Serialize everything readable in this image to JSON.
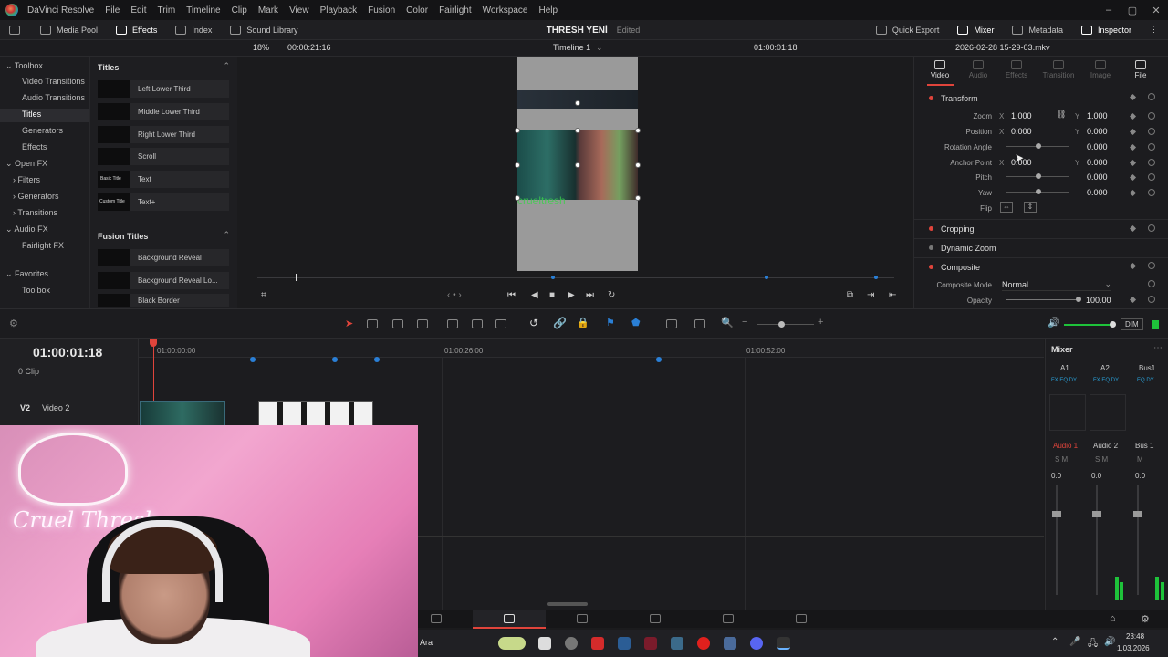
{
  "menubar": {
    "app_title": "DaVinci Resolve",
    "items": [
      "File",
      "Edit",
      "Trim",
      "Timeline",
      "Clip",
      "Mark",
      "View",
      "Playback",
      "Fusion",
      "Color",
      "Fairlight",
      "Workspace",
      "Help"
    ]
  },
  "toolbar": {
    "media_pool": "Media Pool",
    "effects": "Effects",
    "index": "Index",
    "sound_library": "Sound Library",
    "project_title": "THRESH YENİ",
    "project_status": "Edited",
    "quick_export": "Quick Export",
    "mixer": "Mixer",
    "metadata": "Metadata",
    "inspector": "Inspector"
  },
  "subbar": {
    "zoom": "18%",
    "source_timecode": "00:00:21:16",
    "timeline_name": "Timeline 1",
    "record_timecode": "01:00:01:18",
    "clip_name": "2026-02-28 15-29-03.mkv"
  },
  "toolbox": {
    "items": [
      {
        "label": "Toolbox",
        "level": 0
      },
      {
        "label": "Video Transitions",
        "level": 1
      },
      {
        "label": "Audio Transitions",
        "level": 1
      },
      {
        "label": "Titles",
        "level": 1
      },
      {
        "label": "Generators",
        "level": 1
      },
      {
        "label": "Effects",
        "level": 1
      },
      {
        "label": "Open FX",
        "level": 0
      },
      {
        "label": "Filters",
        "level": 1
      },
      {
        "label": "Generators",
        "level": 1
      },
      {
        "label": "Transitions",
        "level": 1
      },
      {
        "label": "Audio FX",
        "level": 0
      },
      {
        "label": "Fairlight FX",
        "level": 1
      },
      {
        "label": "Favorites",
        "level": 0
      },
      {
        "label": "Toolbox",
        "level": 1
      }
    ]
  },
  "titles": {
    "header": "Titles",
    "items": [
      "Left Lower Third",
      "Middle Lower Third",
      "Right Lower Third",
      "Scroll",
      "Text",
      "Text+"
    ],
    "thumb_labels": [
      "",
      "",
      "",
      "",
      "Basic Title",
      "Custom Title"
    ],
    "fusion_header": "Fusion Titles",
    "fusion_items": [
      "Background Reveal",
      "Background Reveal Lo...",
      "Black Border"
    ]
  },
  "viewer": {
    "watermark_text": "crueltresh"
  },
  "inspector": {
    "tabs": [
      "Video",
      "Audio",
      "Effects",
      "Transition",
      "Image",
      "File"
    ],
    "transform_label": "Transform",
    "zoom_label": "Zoom",
    "zoom_x": "1.000",
    "zoom_y": "1.000",
    "position_label": "Position",
    "position_x": "0.000",
    "position_y": "0.000",
    "rotation_label": "Rotation Angle",
    "rotation_val": "0.000",
    "anchor_label": "Anchor Point",
    "anchor_x": "0.000",
    "anchor_y": "0.000",
    "pitch_label": "Pitch",
    "pitch_val": "0.000",
    "yaw_label": "Yaw",
    "yaw_val": "0.000",
    "flip_label": "Flip",
    "x_axis": "X",
    "y_axis": "Y",
    "cropping_label": "Cropping",
    "dynamic_zoom_label": "Dynamic Zoom",
    "composite_label": "Composite",
    "composite_mode_label": "Composite Mode",
    "composite_mode_val": "Normal",
    "opacity_label": "Opacity",
    "opacity_val": "100.00"
  },
  "timeline": {
    "timecode": "01:00:01:18",
    "clip_count": "0 Clip",
    "ruler": [
      "01:00:00:00",
      "01:00:26:00",
      "01:00:52:00"
    ],
    "track_v2_id": "V2",
    "track_v2_name": "Video 2"
  },
  "mixer": {
    "title": "Mixer",
    "channels": [
      "A1",
      "A2",
      "Bus1"
    ],
    "channel_names": [
      "Audio 1",
      "Audio 2",
      "Bus 1"
    ],
    "levels": [
      "0.0",
      "0.0",
      "0.0"
    ],
    "dim_label": "DIM"
  },
  "webcam": {
    "neon_text": "Cruel Thresh"
  },
  "taskbar": {
    "search_text": "Ara",
    "time": "23:48",
    "date": "1.03.2026"
  },
  "colors": {
    "accent": "#e0443b",
    "meter_green": "#1ec23a"
  }
}
